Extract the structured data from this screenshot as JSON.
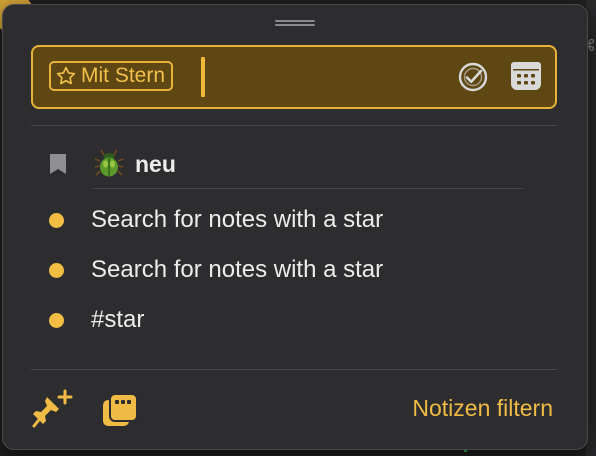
{
  "search": {
    "token_label": "Mit Stern",
    "token_icon": "star-outline-icon",
    "value": "",
    "actions": [
      "check-circle-icon",
      "calendar-icon"
    ],
    "accent_color": "#e8b23a"
  },
  "group": {
    "icon": "bookmark-icon",
    "emoji_icon": "beetle-icon",
    "label": "neu"
  },
  "results": [
    {
      "label": "Search for notes with a star",
      "dot_color": "#f2bd42"
    },
    {
      "label": "Search for notes with a star",
      "dot_color": "#f2bd42"
    },
    {
      "label": "#star",
      "dot_color": "#f2bd42"
    }
  ],
  "footer": {
    "pin_icon": "pin-add-icon",
    "copy_icon": "stack-copy-icon",
    "filter_label": "Notizen filtern"
  }
}
